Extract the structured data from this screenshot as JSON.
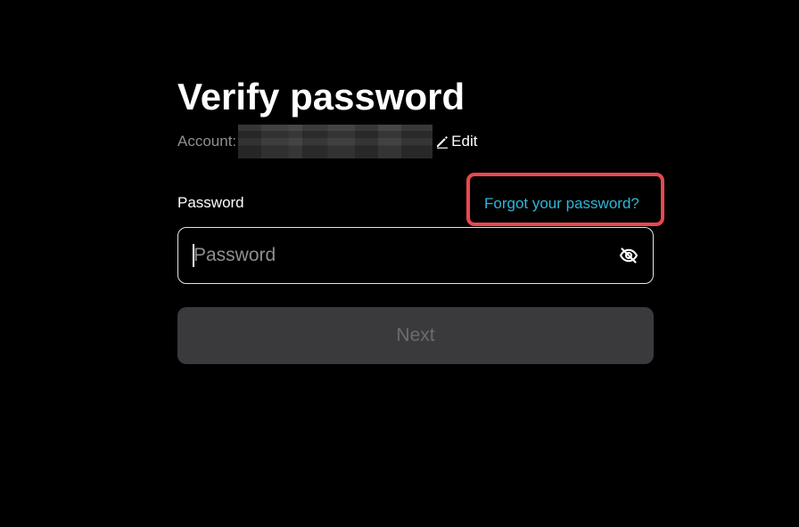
{
  "page": {
    "title": "Verify password"
  },
  "account": {
    "label": "Account:",
    "edit_label": "Edit"
  },
  "password": {
    "label": "Password",
    "placeholder": "Password",
    "value": ""
  },
  "forgot": {
    "label": "Forgot your password?"
  },
  "actions": {
    "next_label": "Next"
  },
  "icons": {
    "edit": "pencil-icon",
    "visibility": "eye-off-icon"
  },
  "colors": {
    "background": "#000000",
    "link": "#2fb6d6",
    "highlight": "#e8484f",
    "button_disabled_bg": "#3a3a3c",
    "button_disabled_text": "#6c6c70"
  }
}
